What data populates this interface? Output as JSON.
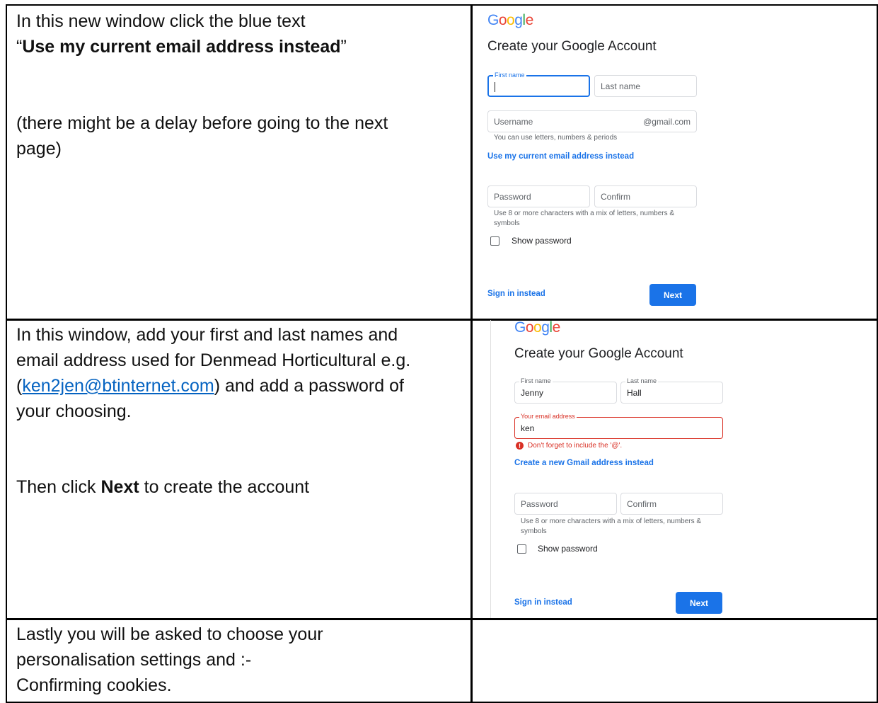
{
  "row1": {
    "line1": "In this new window click the blue text",
    "quote_open": "“",
    "bold": "Use my current email address instead",
    "quote_close": "”",
    "line3a": "(there might be a delay before going to the next",
    "line3b": "page)"
  },
  "row2": {
    "line1": "In this window, add your first and last names and",
    "line2": "email address used for Denmead Horticultural e.g.",
    "paren_open": "(",
    "email_link": "ken2jen@btinternet.com",
    "line3_rest": ") and add a password of",
    "line4": "your choosing.",
    "then_pre": "Then click ",
    "then_bold": "Next",
    "then_post": " to create the account"
  },
  "row3": {
    "line1": "Lastly you will be asked to choose your",
    "line2": "personalisation settings  and :-",
    "line3": "Confirming cookies."
  },
  "form1": {
    "logo": "Google",
    "title": "Create your Google Account",
    "first_name_label": "First name",
    "last_name_placeholder": "Last name",
    "username_placeholder": "Username",
    "suffix": "@gmail.com",
    "username_hint": "You can use letters, numbers & periods",
    "alt_link": "Use my current email address instead",
    "password_placeholder": "Password",
    "confirm_placeholder": "Confirm",
    "password_hint_1": "Use 8 or more characters with a mix of letters, numbers &",
    "password_hint_2": "symbols",
    "show_password": "Show password",
    "sign_in": "Sign in instead",
    "next": "Next"
  },
  "form2": {
    "logo": "Google",
    "title": "Create your Google Account",
    "first_name_label": "First name",
    "first_name_value": "Jenny",
    "last_name_label": "Last name",
    "last_name_value": "Hall",
    "email_label": "Your email address",
    "email_value": "ken",
    "error": "Don't forget to include the '@'.",
    "alt_link": "Create a new Gmail address instead",
    "password_placeholder": "Password",
    "confirm_placeholder": "Confirm",
    "password_hint_1": "Use 8 or more characters with a mix of letters, numbers &",
    "password_hint_2": "symbols",
    "show_password": "Show password",
    "sign_in": "Sign in instead",
    "next": "Next"
  },
  "colors": {
    "google_blue": "#1a73e8",
    "error_red": "#d93025",
    "doc_link": "#0563c1"
  }
}
